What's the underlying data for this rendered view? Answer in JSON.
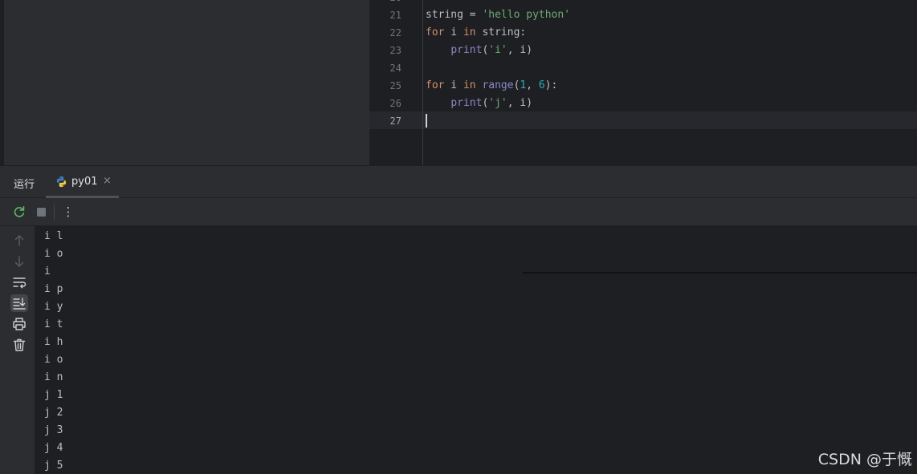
{
  "editor": {
    "lines": [
      {
        "num": "21",
        "tokens": [
          {
            "t": "string = ",
            "c": ""
          },
          {
            "t": "'hello python'",
            "c": "str"
          }
        ]
      },
      {
        "num": "22",
        "tokens": [
          {
            "t": "for",
            "c": "kw"
          },
          {
            "t": " i ",
            "c": ""
          },
          {
            "t": "in",
            "c": "kw"
          },
          {
            "t": " string:",
            "c": ""
          }
        ]
      },
      {
        "num": "23",
        "tokens": [
          {
            "t": "    ",
            "c": ""
          },
          {
            "t": "print",
            "c": "bi"
          },
          {
            "t": "(",
            "c": ""
          },
          {
            "t": "'i'",
            "c": "str"
          },
          {
            "t": ", i)",
            "c": ""
          }
        ]
      },
      {
        "num": "24",
        "tokens": []
      },
      {
        "num": "25",
        "tokens": [
          {
            "t": "for",
            "c": "kw"
          },
          {
            "t": " i ",
            "c": ""
          },
          {
            "t": "in",
            "c": "kw"
          },
          {
            "t": " ",
            "c": ""
          },
          {
            "t": "range",
            "c": "bi"
          },
          {
            "t": "(",
            "c": ""
          },
          {
            "t": "1",
            "c": "num"
          },
          {
            "t": ", ",
            "c": ""
          },
          {
            "t": "6",
            "c": "num"
          },
          {
            "t": "):",
            "c": ""
          }
        ]
      },
      {
        "num": "26",
        "tokens": [
          {
            "t": "    ",
            "c": ""
          },
          {
            "t": "print",
            "c": "bi"
          },
          {
            "t": "(",
            "c": ""
          },
          {
            "t": "'j'",
            "c": "str"
          },
          {
            "t": ", i)",
            "c": ""
          }
        ]
      },
      {
        "num": "27",
        "tokens": []
      }
    ],
    "current_line": "27"
  },
  "run_panel": {
    "title": "运行",
    "tab_label": "py01",
    "tab_close": "×",
    "toolbar_more": "⋮"
  },
  "console": {
    "output": [
      "i l",
      "i o",
      "i",
      "i p",
      "i y",
      "i t",
      "i h",
      "i o",
      "i n",
      "j 1",
      "j 2",
      "j 3",
      "j 4",
      "j 5"
    ]
  },
  "watermark": "CSDN @于慨",
  "colors": {
    "keyword": "#cf8e6d",
    "string": "#6aab73",
    "builtin": "#8888c6",
    "number": "#2aacb8",
    "rerun_icon": "#5fb865"
  }
}
